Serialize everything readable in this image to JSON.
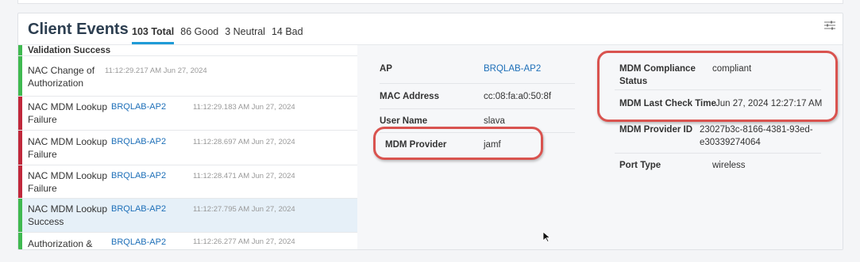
{
  "header": {
    "title": "Client Events",
    "total": "103 Total",
    "good": "86 Good",
    "neutral": "3 Neutral",
    "bad": "14 Bad"
  },
  "events": [
    {
      "name": "Validation Success",
      "ap": "",
      "time": "",
      "status": "good"
    },
    {
      "name": "NAC Change of Authorization",
      "ap": "",
      "time": "11:12:29.217 AM Jun 27, 2024",
      "status": "good"
    },
    {
      "name": "NAC MDM Lookup Failure",
      "ap": "BRQLAB-AP2",
      "time": "11:12:29.183 AM Jun 27, 2024",
      "status": "bad"
    },
    {
      "name": "NAC MDM Lookup Failure",
      "ap": "BRQLAB-AP2",
      "time": "11:12:28.697 AM Jun 27, 2024",
      "status": "bad"
    },
    {
      "name": "NAC MDM Lookup Failure",
      "ap": "BRQLAB-AP2",
      "time": "11:12:28.471 AM Jun 27, 2024",
      "status": "bad"
    },
    {
      "name": "NAC MDM Lookup Success",
      "ap": "BRQLAB-AP2",
      "time": "11:12:27.795 AM Jun 27, 2024",
      "status": "good"
    },
    {
      "name": "Authorization &",
      "ap": "BRQLAB-AP2",
      "time": "11:12:26.277 AM Jun 27, 2024",
      "status": "good"
    }
  ],
  "details": {
    "ap_label": "AP",
    "ap_value": "BRQLAB-AP2",
    "mac_label": "MAC Address",
    "mac_value": "cc:08:fa:a0:50:8f",
    "user_label": "User Name",
    "user_value": "slava",
    "mdm_provider_label": "MDM Provider",
    "mdm_provider_value": "jamf",
    "compliance_label": "MDM Compliance Status",
    "compliance_value": "compliant",
    "last_check_label": "MDM Last Check Time",
    "last_check_value": "Jun 27, 2024 12:27:17 AM",
    "provider_id_label": "MDM Provider ID",
    "provider_id_value": "23027b3c-8166-4381-93ed-e30339274064",
    "port_label": "Port Type",
    "port_value": "wireless"
  },
  "colors": {
    "good": "#3fb950",
    "bad": "#c0283b",
    "highlight": "#d9534f",
    "link": "#1d6fb8"
  },
  "icons": {
    "filter": "filter-sliders-icon",
    "cursor": "mouse-pointer-icon"
  }
}
